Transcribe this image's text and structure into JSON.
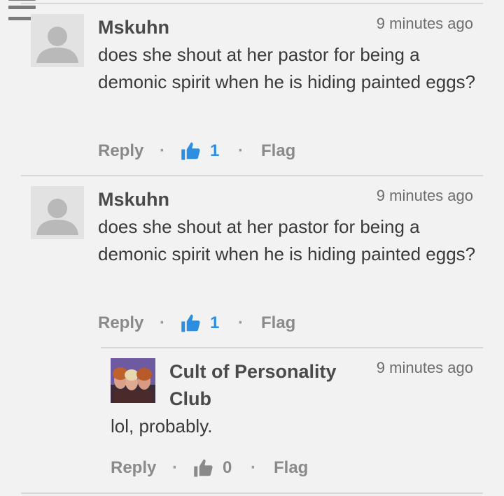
{
  "comments": [
    {
      "author": "Mskuhn",
      "time": "9 minutes ago",
      "body": "does she shout at her pastor for being a demonic spirit when he is hiding painted eggs?",
      "reply_label": "Reply",
      "likes": "1",
      "flag_label": "Flag"
    },
    {
      "author": "Mskuhn",
      "time": "9 minutes ago",
      "body": "does she shout at her pastor for being a demonic spirit when he is hiding painted eggs?",
      "reply_label": "Reply",
      "likes": "1",
      "flag_label": "Flag"
    },
    {
      "author_line1": "Cult of Personality",
      "author_line2": "Club",
      "time": "9 minutes ago",
      "body": "lol, probably.",
      "reply_label": "Reply",
      "likes": "0",
      "flag_label": "Flag"
    }
  ],
  "separator": "·",
  "colors": {
    "like_active": "#2d8ee0",
    "like_inactive": "#8a8a8a",
    "background": "#f2f2f2"
  },
  "icons": {
    "menu": "hamburger-menu-icon",
    "like": "thumbs-up-icon",
    "avatar_default": "default-user-avatar"
  }
}
